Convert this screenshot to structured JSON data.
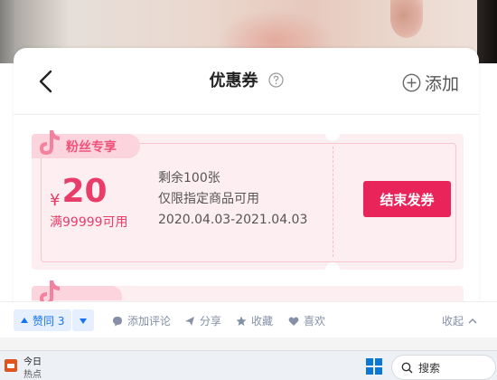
{
  "nav": {
    "title": "优惠券",
    "add_label": "添加"
  },
  "coupon": {
    "badge": "粉丝专享",
    "currency": "¥",
    "amount": "20",
    "condition": "满99999可用",
    "remaining": "剩余100张",
    "scope": "仅限指定商品可用",
    "validity": "2020.04.03-2021.04.03",
    "action_label": "结束发券"
  },
  "actions": {
    "vote_label": "赞同 3",
    "comment": "添加评论",
    "share": "分享",
    "favorite": "收藏",
    "like": "喜欢",
    "collapse": "收起"
  },
  "taskbar": {
    "news_title": "今日",
    "news_sub": "热点",
    "search_label": "搜索"
  },
  "colors": {
    "accent": "#e8245a",
    "coupon_text": "#e83d68",
    "coupon_bg": "#fdeef1",
    "link_blue": "#1772f6"
  }
}
